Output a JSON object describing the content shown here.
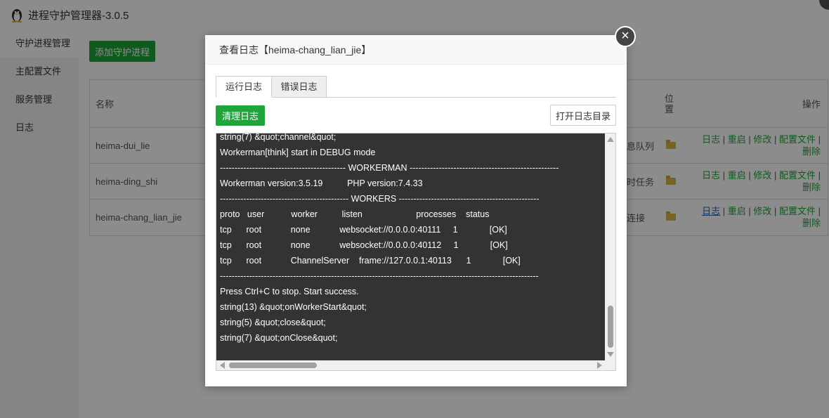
{
  "app": {
    "title": "进程守护管理器-3.0.5"
  },
  "sidebar": {
    "items": [
      {
        "label": "守护进程管理"
      },
      {
        "label": "主配置文件"
      },
      {
        "label": "服务管理"
      },
      {
        "label": "日志"
      }
    ]
  },
  "main": {
    "add_button": "添加守护进程",
    "table": {
      "headers": {
        "name": "名称",
        "location": "位置",
        "ops": "操作"
      },
      "rows": [
        {
          "name": "heima-dui_lie",
          "desc": "息队列"
        },
        {
          "name": "heima-ding_shi",
          "desc": "时任务"
        },
        {
          "name": "heima-chang_lian_jie",
          "desc": "连接"
        }
      ],
      "ops": {
        "log": "日志",
        "sep": " | ",
        "restart": "重启",
        "edit": "修改",
        "config": "配置文件",
        "delete": "删除"
      }
    }
  },
  "modal": {
    "title": "查看日志【heima-chang_lian_jie】",
    "close_symbol": "×",
    "tabs": [
      {
        "label": "运行日志"
      },
      {
        "label": "错误日志"
      }
    ],
    "clear_button": "清理日志",
    "open_dir_button": "打开日志目录",
    "log_lines": [
      "string(7) &quot;channel&quot;",
      "Workerman[think] start in DEBUG mode",
      "------------------------------------------- WORKERMAN ---------------------------------------------------",
      "Workerman version:3.5.19          PHP version:7.4.33",
      "-------------------------------------------- WORKERS ------------------------------------------------",
      "proto   user           worker          listen                      processes    status",
      "tcp      root            none            websocket://0.0.0.0:40111     1             [OK]",
      "tcp      root            none            websocket://0.0.0.0:40112     1             [OK]",
      "tcp      root            ChannelServer    frame://127.0.0.1:40113      1             [OK]",
      "-------------------------------------------------------------------------------------------------------------",
      "Press Ctrl+C to stop. Start success.",
      "string(13) &quot;onWorkerStart&quot;",
      "string(5) &quot;close&quot;",
      "string(7) &quot;onClose&quot;"
    ]
  },
  "colors": {
    "primary_green": "#20a53a",
    "log_bg": "#333333",
    "link_blue": "#2060c0"
  }
}
